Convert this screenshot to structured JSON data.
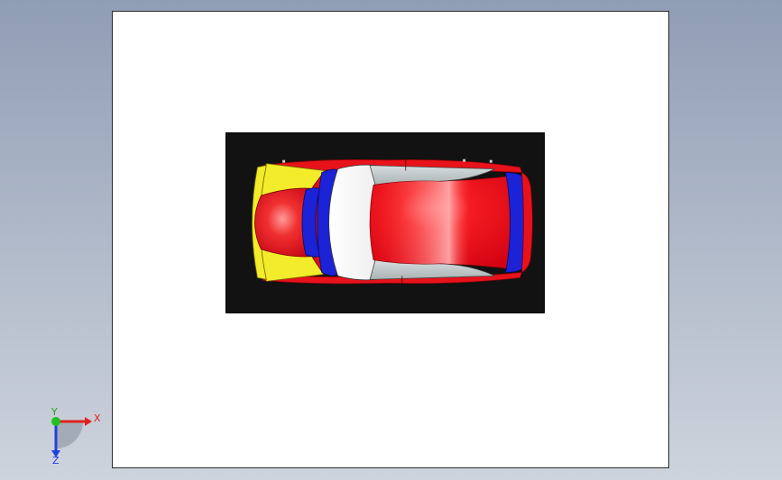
{
  "triad": {
    "x_label": "X",
    "y_label": "Y",
    "z_label": "Z"
  },
  "colors": {
    "background_top": "#8f9db5",
    "sheet": "#ffffff",
    "view_background": "#121212",
    "body_red": "#e8121a",
    "glass_blue": "#1c22d6",
    "headlight_yellow": "#f2ec2a",
    "axis_x": "#e02020",
    "axis_y": "#20c020",
    "axis_z": "#2040e0"
  },
  "icons": {
    "triad": "coordinate-triad-icon"
  }
}
